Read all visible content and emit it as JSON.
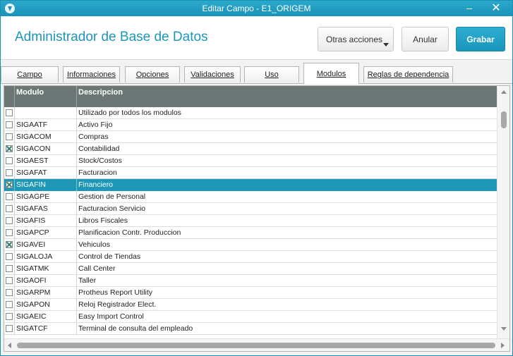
{
  "window": {
    "title": "Editar Campo - E1_ORIGEM",
    "minimize_glyph": "–",
    "close_glyph": "✕"
  },
  "header": {
    "title": "Administrador de Base de Datos",
    "buttons": {
      "more_actions": "Otras acciones",
      "cancel": "Anular",
      "save": "Grabar"
    },
    "accent_color": "#1d96b8"
  },
  "tabs": [
    {
      "label": "Campo",
      "active": false
    },
    {
      "label": "Informaciones",
      "active": false
    },
    {
      "label": "Opciones",
      "active": false
    },
    {
      "label": "Validaciones",
      "active": false
    },
    {
      "label": "Uso",
      "active": false
    },
    {
      "label": "Modulos",
      "active": true
    },
    {
      "label": "Reglas de dependencia",
      "active": false
    }
  ],
  "grid": {
    "columns": {
      "module": "Modulo",
      "description": "Descripcion"
    },
    "header_color": "#6c7775",
    "selected_color": "#1f98b7",
    "rows": [
      {
        "checked": false,
        "module": "",
        "description": "Utilizado por todos los modulos",
        "selected": false
      },
      {
        "checked": false,
        "module": "SIGAATF",
        "description": "Activo Fijo",
        "selected": false
      },
      {
        "checked": false,
        "module": "SIGACOM",
        "description": "Compras",
        "selected": false
      },
      {
        "checked": true,
        "module": "SIGACON",
        "description": "Contabilidad",
        "selected": false
      },
      {
        "checked": false,
        "module": "SIGAEST",
        "description": "Stock/Costos",
        "selected": false
      },
      {
        "checked": false,
        "module": "SIGAFAT",
        "description": "Facturacion",
        "selected": false
      },
      {
        "checked": true,
        "module": "SIGAFIN",
        "description": "Financiero",
        "selected": true
      },
      {
        "checked": false,
        "module": "SIGAGPE",
        "description": "Gestion de Personal",
        "selected": false
      },
      {
        "checked": false,
        "module": "SIGAFAS",
        "description": "Facturacion Servicio",
        "selected": false
      },
      {
        "checked": false,
        "module": "SIGAFIS",
        "description": "Libros Fiscales",
        "selected": false
      },
      {
        "checked": false,
        "module": "SIGAPCP",
        "description": "Planificacion Contr. Produccion",
        "selected": false
      },
      {
        "checked": true,
        "module": "SIGAVEI",
        "description": "Vehiculos",
        "selected": false
      },
      {
        "checked": false,
        "module": "SIGALOJA",
        "description": "Control de Tiendas",
        "selected": false
      },
      {
        "checked": false,
        "module": "SIGATMK",
        "description": "Call Center",
        "selected": false
      },
      {
        "checked": false,
        "module": "SIGAOFI",
        "description": "Taller",
        "selected": false
      },
      {
        "checked": false,
        "module": "SIGARPM",
        "description": "Protheus Report Utility",
        "selected": false
      },
      {
        "checked": false,
        "module": "SIGAPON",
        "description": "Reloj Registrador Elect.",
        "selected": false
      },
      {
        "checked": false,
        "module": "SIGAEIC",
        "description": "Easy Import Control",
        "selected": false
      },
      {
        "checked": false,
        "module": "SIGATCF",
        "description": "Terminal de consulta del empleado",
        "selected": false
      }
    ]
  }
}
